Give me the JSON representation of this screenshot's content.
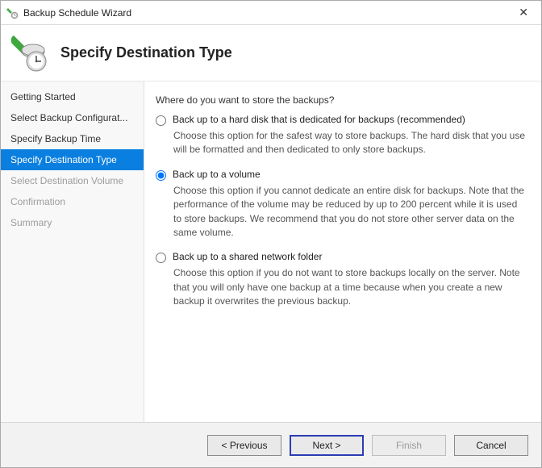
{
  "window": {
    "title": "Backup Schedule Wizard"
  },
  "header": {
    "title": "Specify Destination Type"
  },
  "sidebar": {
    "steps": [
      {
        "label": "Getting Started",
        "state": "past"
      },
      {
        "label": "Select Backup Configurat...",
        "state": "past"
      },
      {
        "label": "Specify Backup Time",
        "state": "past"
      },
      {
        "label": "Specify Destination Type",
        "state": "current"
      },
      {
        "label": "Select Destination Volume",
        "state": "future"
      },
      {
        "label": "Confirmation",
        "state": "future"
      },
      {
        "label": "Summary",
        "state": "future"
      }
    ]
  },
  "content": {
    "question": "Where do you want to store the backups?",
    "options": [
      {
        "label": "Back up to a hard disk that is dedicated for backups (recommended)",
        "description": "Choose this option for the safest way to store backups. The hard disk that you use will be formatted and then dedicated to only store backups.",
        "selected": false
      },
      {
        "label": "Back up to a volume",
        "description": "Choose this option if you cannot dedicate an entire disk for backups. Note that the performance of the volume may be reduced by up to 200 percent while it is used to store backups. We recommend that you do not store other server data on the same volume.",
        "selected": true
      },
      {
        "label": "Back up to a shared network folder",
        "description": "Choose this option if you do not want to store backups locally on the server. Note that you will only have one backup at a time because when you create a new backup it overwrites the previous backup.",
        "selected": false
      }
    ]
  },
  "footer": {
    "previous": "< Previous",
    "next": "Next >",
    "finish": "Finish",
    "cancel": "Cancel"
  }
}
